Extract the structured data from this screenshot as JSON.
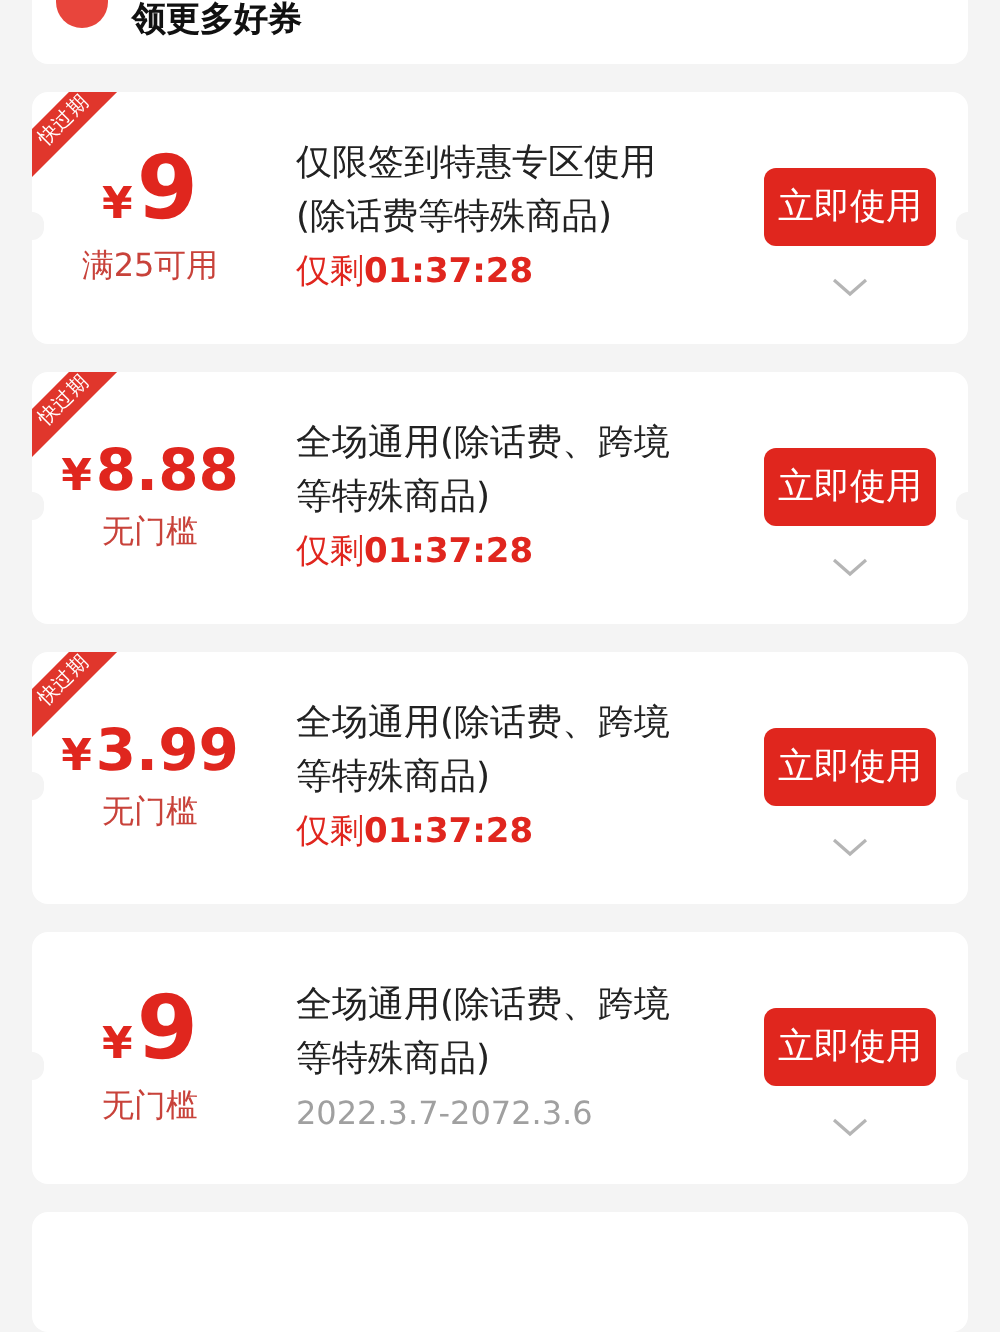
{
  "header": {
    "title": "领更多好券"
  },
  "coupons": [
    {
      "expiring": true,
      "badge": "快过期",
      "currency": "¥",
      "amount": "9",
      "condition": "满25可用",
      "description": "仅限签到特惠专区使用(除话费等特殊商品)",
      "kind": "countdown",
      "remaining_label": "仅剩",
      "remaining_time": "01:37:28",
      "button": "立即使用"
    },
    {
      "expiring": true,
      "badge": "快过期",
      "currency": "¥",
      "amount": "8.88",
      "condition": "无门槛",
      "description": "全场通用(除话费、跨境等特殊商品)",
      "kind": "countdown",
      "remaining_label": "仅剩",
      "remaining_time": "01:37:28",
      "button": "立即使用"
    },
    {
      "expiring": true,
      "badge": "快过期",
      "currency": "¥",
      "amount": "3.99",
      "condition": "无门槛",
      "description": "全场通用(除话费、跨境等特殊商品)",
      "kind": "countdown",
      "remaining_label": "仅剩",
      "remaining_time": "01:37:28",
      "button": "立即使用"
    },
    {
      "expiring": false,
      "currency": "¥",
      "amount": "9",
      "condition": "无门槛",
      "description": "全场通用(除话费、跨境等特殊商品)",
      "kind": "validity",
      "validity": "2022.3.7-2072.3.6",
      "button": "立即使用"
    }
  ]
}
